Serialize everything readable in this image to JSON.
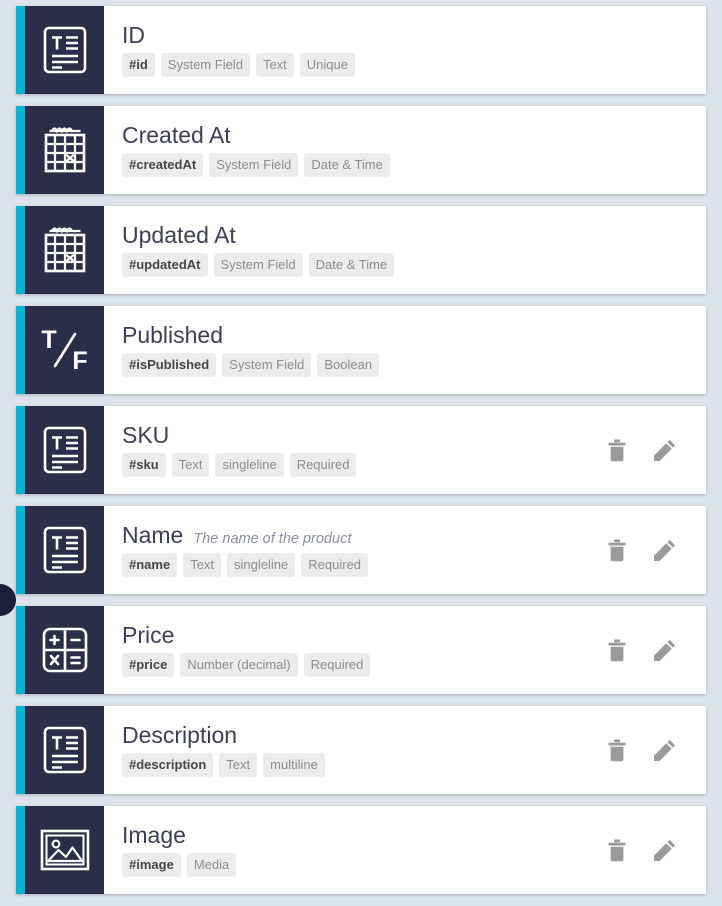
{
  "view": {
    "name": "content-type-field-list",
    "background_color": "#dce3ea",
    "accent_color": "#00b5d6",
    "icon_panel_color": "#2c2e49",
    "card_color": "#ffffff",
    "title_color": "#3c3f58",
    "tag_background": "#ececec",
    "tag_text_color": "#8d8d8d",
    "tag_key_color": "#464646",
    "action_icon_color": "#9a9a9a"
  },
  "handle": {
    "label": "drag-handle",
    "color": "#1d1f38"
  },
  "actions": {
    "delete_label": "Delete",
    "edit_label": "Edit",
    "delete_icon": "trash-icon",
    "edit_icon": "pencil-icon"
  },
  "fields": [
    {
      "title": "ID",
      "description": "",
      "icon": "text-field-icon",
      "tags": [
        "#id",
        "System Field",
        "Text",
        "Unique"
      ],
      "has_actions": false
    },
    {
      "title": "Created At",
      "description": "",
      "icon": "calendar-icon",
      "tags": [
        "#createdAt",
        "System Field",
        "Date & Time"
      ],
      "has_actions": false
    },
    {
      "title": "Updated At",
      "description": "",
      "icon": "calendar-icon",
      "tags": [
        "#updatedAt",
        "System Field",
        "Date & Time"
      ],
      "has_actions": false
    },
    {
      "title": "Published",
      "description": "",
      "icon": "boolean-icon",
      "tags": [
        "#isPublished",
        "System Field",
        "Boolean"
      ],
      "has_actions": false
    },
    {
      "title": "SKU",
      "description": "",
      "icon": "text-field-icon",
      "tags": [
        "#sku",
        "Text",
        "singleline",
        "Required"
      ],
      "has_actions": true
    },
    {
      "title": "Name",
      "description": "The name of the product",
      "icon": "text-field-icon",
      "tags": [
        "#name",
        "Text",
        "singleline",
        "Required"
      ],
      "has_actions": true
    },
    {
      "title": "Price",
      "description": "",
      "icon": "number-icon",
      "tags": [
        "#price",
        "Number (decimal)",
        "Required"
      ],
      "has_actions": true
    },
    {
      "title": "Description",
      "description": "",
      "icon": "text-field-icon",
      "tags": [
        "#description",
        "Text",
        "multiline"
      ],
      "has_actions": true
    },
    {
      "title": "Image",
      "description": "",
      "icon": "media-image-icon",
      "tags": [
        "#image",
        "Media"
      ],
      "has_actions": true
    }
  ]
}
